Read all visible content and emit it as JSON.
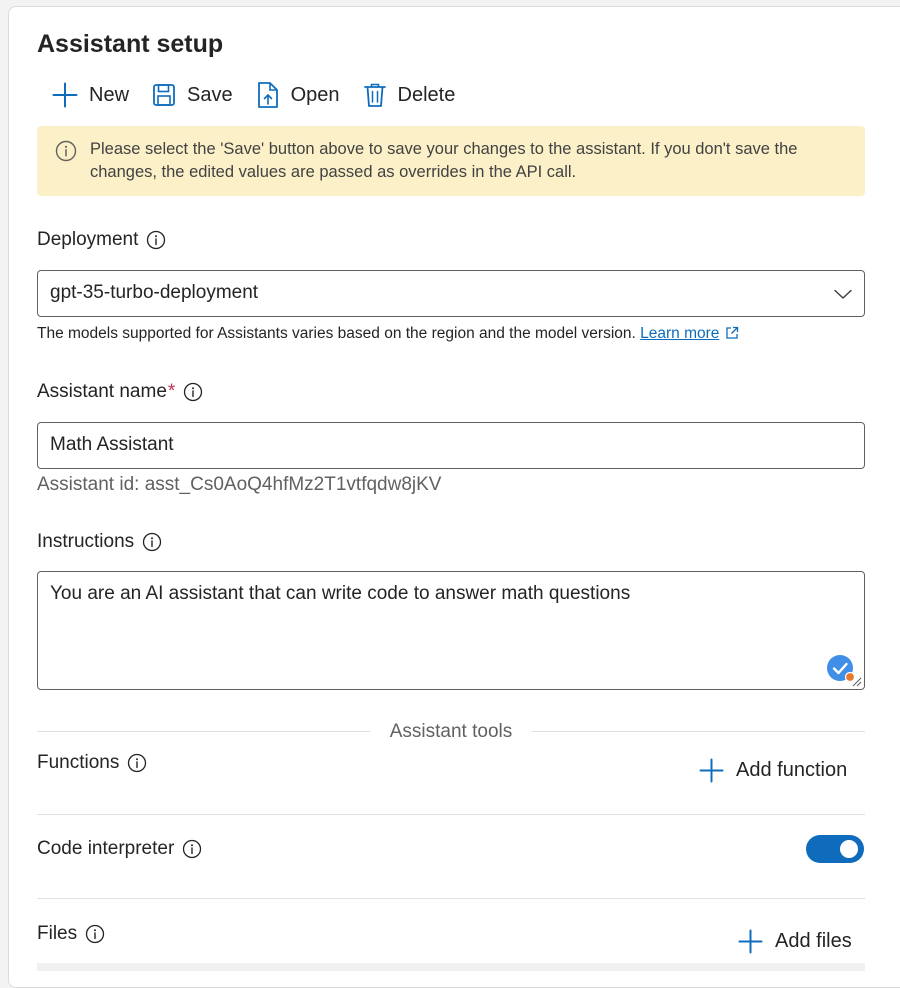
{
  "header": {
    "title": "Assistant setup"
  },
  "toolbar": {
    "new_label": "New",
    "save_label": "Save",
    "open_label": "Open",
    "delete_label": "Delete"
  },
  "banner": {
    "text": "Please select the 'Save' button above to save your changes to the assistant. If you don't save the changes, the edited values are passed as overrides in the API call.",
    "icon": "info-icon",
    "background_color": "#fbf0c7"
  },
  "deployment": {
    "label": "Deployment",
    "selected_value": "gpt-35-turbo-deployment",
    "hint": "The models supported for Assistants varies based on the region and the model version.",
    "learn_more": "Learn more"
  },
  "assistant_name": {
    "label": "Assistant name",
    "required_mark": "*",
    "value": "Math Assistant",
    "assistant_id": "Assistant id: asst_Cs0AoQ4hfMz2T1vtfqdw8jKV"
  },
  "instructions": {
    "label": "Instructions",
    "value": "You are an AI assistant that can write code to answer math questions"
  },
  "tools": {
    "section_title": "Assistant tools",
    "functions_label": "Functions",
    "add_function_label": "Add function",
    "code_interpreter_label": "Code interpreter",
    "code_interpreter_enabled": true,
    "files_label": "Files",
    "add_files_label": "Add files"
  },
  "colors": {
    "accent": "#0f6cbd",
    "link": "#0f6cbd",
    "required": "#c4314b"
  }
}
